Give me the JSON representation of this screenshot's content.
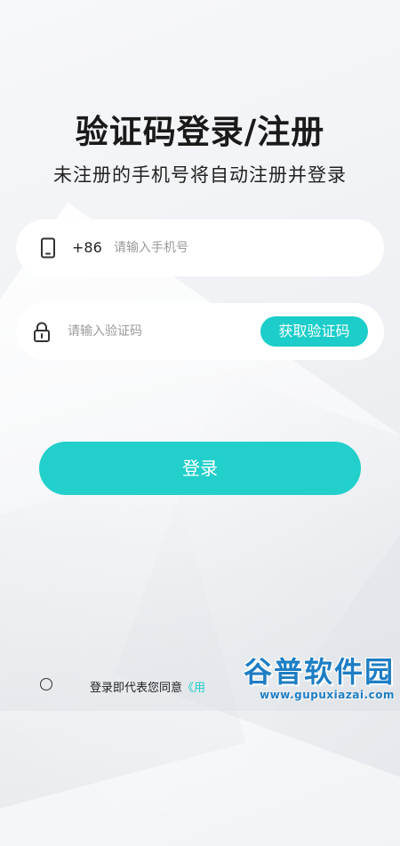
{
  "header": {
    "title": "验证码登录/注册",
    "subtitle": "未注册的手机号将自动注册并登录"
  },
  "phone": {
    "country_code": "+86",
    "placeholder": "请输入手机号",
    "value": "",
    "icon": "phone-icon"
  },
  "code": {
    "placeholder": "请输入验证码",
    "value": "",
    "icon": "lock-icon",
    "button_label": "获取验证码"
  },
  "login": {
    "button_label": "登录"
  },
  "agreement": {
    "checked": false,
    "prefix": "登录即代表您同意",
    "link_text": "《用"
  },
  "watermark": {
    "title": "谷普软件园",
    "url": "www.gupuxiazai.com"
  },
  "colors": {
    "accent": "#22cfcb",
    "title": "#1a1a1a",
    "watermark": "#1e7ec4"
  }
}
